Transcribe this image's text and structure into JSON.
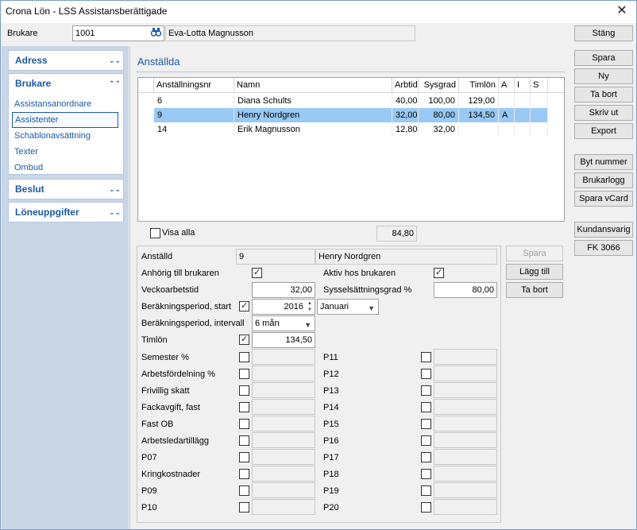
{
  "window": {
    "title": "Crona Lön - LSS Assistansberättigade"
  },
  "top": {
    "brukare_label": "Brukare",
    "brukare_id": "1001",
    "brukare_name": "Eva-Lotta Magnusson",
    "close_button": "Stäng"
  },
  "nav": {
    "adress": "Adress",
    "brukare": "Brukare",
    "brukare_items": [
      "Assistansanordnare",
      "Assistenter",
      "Schablonavsättning",
      "Texter",
      "Ombud"
    ],
    "beslut": "Beslut",
    "loneuppgifter": "Löneuppgifter"
  },
  "section": {
    "title": "Anställda"
  },
  "table": {
    "columns": [
      "Anställningsnr",
      "Namn",
      "Arbtid",
      "Sysgrad",
      "Timlön",
      "A",
      "I",
      "S"
    ],
    "rows": [
      [
        "6",
        "Diana Schults",
        "40,00",
        "100,00",
        "129,00",
        "",
        "",
        ""
      ],
      [
        "9",
        "Henry Nordgren",
        "32,00",
        "80,00",
        "134,50",
        "A",
        "",
        ""
      ],
      [
        "14",
        "Erik Magnusson",
        "12,80",
        "32,00",
        "",
        "",
        "",
        ""
      ]
    ],
    "selected_row": 1
  },
  "visa_alla": {
    "label": "Visa alla",
    "total": "84,80"
  },
  "form": {
    "anstalld_label": "Anställd",
    "anstalld_nr": "9",
    "anstalld_namn": "Henry Nordgren",
    "anhorig_label": "Anhörig till brukaren",
    "aktiv_label": "Aktiv hos brukaren",
    "vecko_label": "Veckoarbetstid",
    "vecko_value": "32,00",
    "syssel_label": "Sysselsättningsgrad %",
    "syssel_value": "80,00",
    "period_start_label": "Beräkningsperiod, start",
    "period_start_year": "2016",
    "period_start_month": "Januari",
    "period_int_label": "Beräkningsperiod, intervall",
    "period_int_value": "6 mån",
    "timlon_label": "Timlön",
    "timlon_value": "134,50",
    "left_fields": [
      "Semester %",
      "Arbetsfördelning %",
      "Frivillig skatt",
      "Fackavgift, fast",
      "Fast OB",
      "Arbetsledartillägg",
      "P07",
      "Kringkostnader",
      "P09",
      "P10"
    ],
    "right_fields": [
      "P11",
      "P12",
      "P13",
      "P14",
      "P15",
      "P16",
      "P17",
      "P18",
      "P19",
      "P20"
    ]
  },
  "form_buttons": {
    "spara": "Spara",
    "lagg_till": "Lägg till",
    "ta_bort": "Ta bort"
  },
  "side_buttons": {
    "group1": [
      "Spara",
      "Ny",
      "Ta bort",
      "Skriv ut",
      "Export"
    ],
    "group2": [
      "Byt nummer",
      "Brukarlogg",
      "Spara vCard"
    ],
    "group3": [
      "Kundansvarig",
      "FK 3066"
    ]
  }
}
